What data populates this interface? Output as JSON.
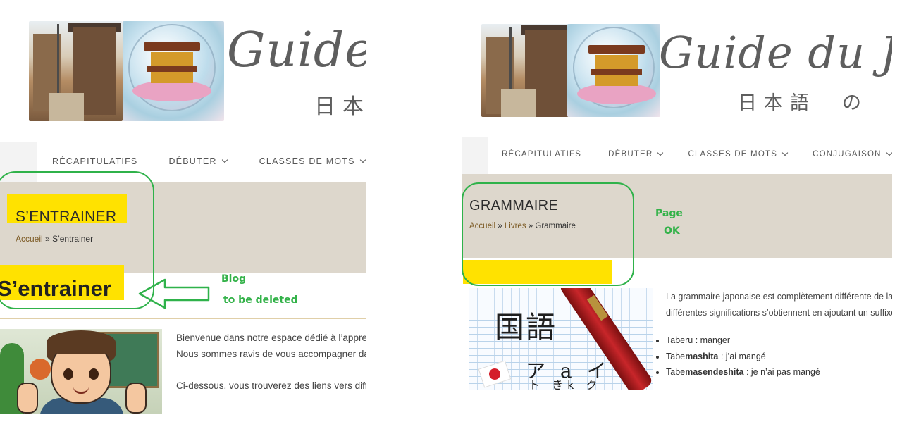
{
  "left_panel": {
    "site_title": "Guide",
    "site_subtitle": "日本",
    "nav": [
      {
        "label": "RÉCAPITULATIFS",
        "has_dropdown": false
      },
      {
        "label": "DÉBUTER",
        "has_dropdown": true
      },
      {
        "label": "CLASSES DE MOTS",
        "has_dropdown": true
      }
    ],
    "hero_title": "S’ENTRAINER",
    "breadcrumb": {
      "home": "Accueil",
      "separator": "»",
      "current": "S’entrainer"
    },
    "page_heading": "S’entrainer",
    "annotation": {
      "line1": "Blog",
      "line2": "to be deleted"
    },
    "intro_lines": [
      "Bienvenue dans notre espace dédié à l’appre",
      "Nous sommes ravis de vous accompagner da",
      "Ci-dessous, vous trouverez des liens vers diff"
    ]
  },
  "right_panel": {
    "site_title": "Guide du Ja",
    "site_subtitle": "日本語　の",
    "nav": [
      {
        "label": "RÉCAPITULATIFS",
        "has_dropdown": false
      },
      {
        "label": "DÉBUTER",
        "has_dropdown": true
      },
      {
        "label": "CLASSES DE MOTS",
        "has_dropdown": true
      },
      {
        "label": "CONJUGAISON",
        "has_dropdown": true
      }
    ],
    "hero_title": "GRAMMAIRE",
    "breadcrumb": {
      "home": "Accueil",
      "separator": "»",
      "middle": "Livres",
      "current": "Grammaire"
    },
    "annotation": {
      "line1": "Page",
      "line2": "OK"
    },
    "intro_lines": [
      "La grammaire japonaise est complètement différente de la n",
      "différentes significations s’obtiennent en ajoutant un suffixe à"
    ],
    "bullets": [
      {
        "prefix": "Taberu",
        "bold": "",
        "rest": " : manger"
      },
      {
        "prefix": "Tabe",
        "bold": "mashita",
        "rest": " : j’ai mangé"
      },
      {
        "prefix": "Tabe",
        "bold": "masendeshita",
        "rest": " : je n’ai pas mangé"
      }
    ],
    "kanji_image_text": {
      "main": "国語",
      "kana": "ア a イ i ウ",
      "romaji": "ト  きk  ク"
    }
  },
  "colors": {
    "hero_bg": "#ddd7cc",
    "highlight": "#ffe200",
    "annotation_green": "#2fb24a",
    "breadcrumb_link": "#7c5a24"
  }
}
